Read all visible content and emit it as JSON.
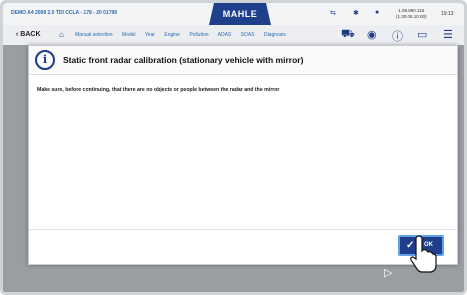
{
  "statusbar": {
    "vehicle": "DEMO A4 2008 2.0 TDI CCLA - 178 - 20 01799",
    "brand": "MAHLE",
    "coords_line1": "1.08.890.115",
    "coords_line2": "(1.30.06.10.00)",
    "time": "19:13",
    "icons": [
      "network-icon",
      "bluetooth-icon",
      "wifi-icon"
    ]
  },
  "toolbar": {
    "back_label": "BACK",
    "nav_items": [
      "Manual selection",
      "Model",
      "Year",
      "Engine",
      "Pollution",
      "ADAS",
      "SOAS",
      "Diagnosis"
    ],
    "icons": [
      "home-icon",
      "vehicle-icon",
      "signal-icon",
      "info-icon",
      "menu-icon"
    ]
  },
  "dialog": {
    "title": "Static front radar calibration (stationary vehicle with mirror)",
    "message": "Make sure, before continuing, that there are no objects or people between the radar and the mirror",
    "ok_label": "OK"
  },
  "colors": {
    "accent": "#1f3f8c",
    "highlight": "#5fa3e6"
  }
}
